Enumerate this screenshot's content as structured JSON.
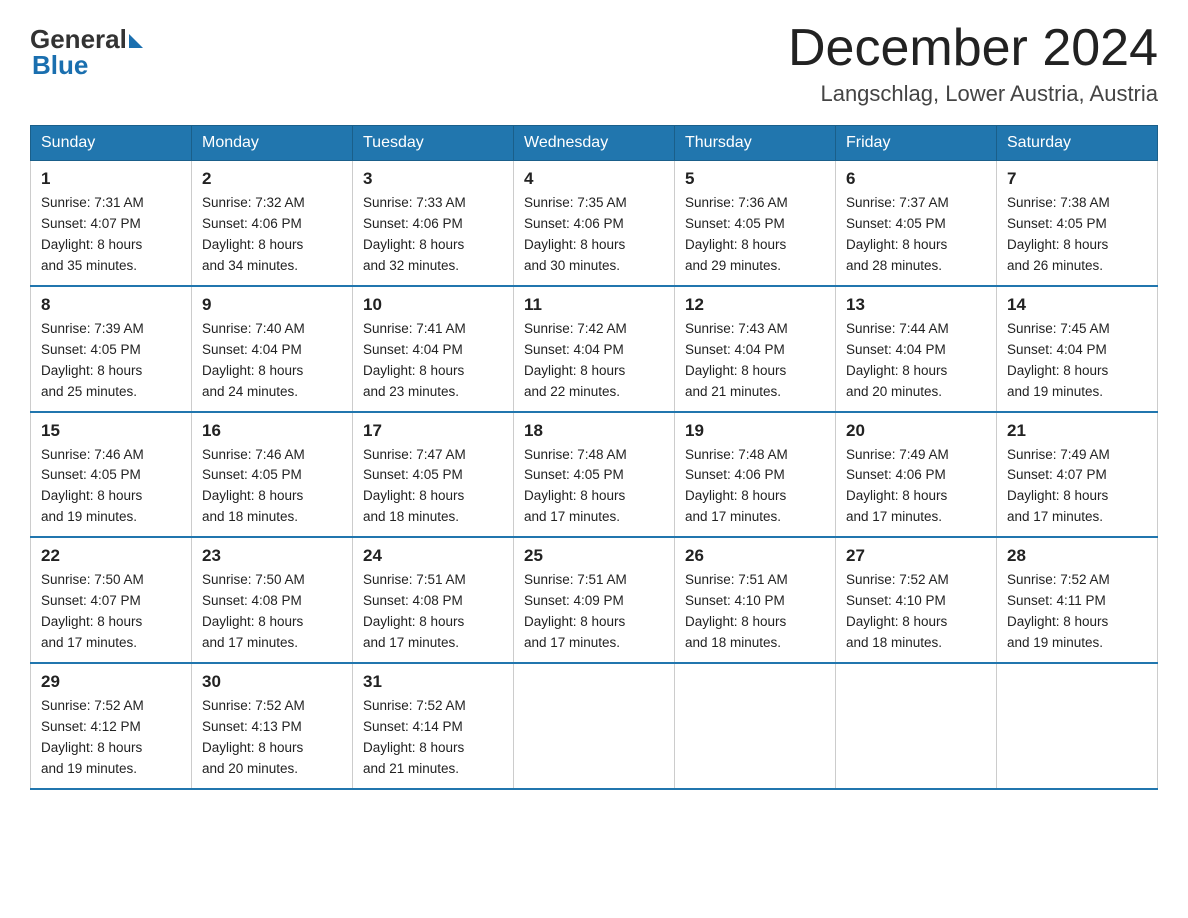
{
  "header": {
    "logo": {
      "general": "General",
      "blue": "Blue",
      "tagline": "GeneralBlue"
    },
    "title": "December 2024",
    "location": "Langschlag, Lower Austria, Austria"
  },
  "weekdays": [
    "Sunday",
    "Monday",
    "Tuesday",
    "Wednesday",
    "Thursday",
    "Friday",
    "Saturday"
  ],
  "weeks": [
    [
      {
        "day": "1",
        "sunrise": "7:31 AM",
        "sunset": "4:07 PM",
        "daylight": "8 hours and 35 minutes."
      },
      {
        "day": "2",
        "sunrise": "7:32 AM",
        "sunset": "4:06 PM",
        "daylight": "8 hours and 34 minutes."
      },
      {
        "day": "3",
        "sunrise": "7:33 AM",
        "sunset": "4:06 PM",
        "daylight": "8 hours and 32 minutes."
      },
      {
        "day": "4",
        "sunrise": "7:35 AM",
        "sunset": "4:06 PM",
        "daylight": "8 hours and 30 minutes."
      },
      {
        "day": "5",
        "sunrise": "7:36 AM",
        "sunset": "4:05 PM",
        "daylight": "8 hours and 29 minutes."
      },
      {
        "day": "6",
        "sunrise": "7:37 AM",
        "sunset": "4:05 PM",
        "daylight": "8 hours and 28 minutes."
      },
      {
        "day": "7",
        "sunrise": "7:38 AM",
        "sunset": "4:05 PM",
        "daylight": "8 hours and 26 minutes."
      }
    ],
    [
      {
        "day": "8",
        "sunrise": "7:39 AM",
        "sunset": "4:05 PM",
        "daylight": "8 hours and 25 minutes."
      },
      {
        "day": "9",
        "sunrise": "7:40 AM",
        "sunset": "4:04 PM",
        "daylight": "8 hours and 24 minutes."
      },
      {
        "day": "10",
        "sunrise": "7:41 AM",
        "sunset": "4:04 PM",
        "daylight": "8 hours and 23 minutes."
      },
      {
        "day": "11",
        "sunrise": "7:42 AM",
        "sunset": "4:04 PM",
        "daylight": "8 hours and 22 minutes."
      },
      {
        "day": "12",
        "sunrise": "7:43 AM",
        "sunset": "4:04 PM",
        "daylight": "8 hours and 21 minutes."
      },
      {
        "day": "13",
        "sunrise": "7:44 AM",
        "sunset": "4:04 PM",
        "daylight": "8 hours and 20 minutes."
      },
      {
        "day": "14",
        "sunrise": "7:45 AM",
        "sunset": "4:04 PM",
        "daylight": "8 hours and 19 minutes."
      }
    ],
    [
      {
        "day": "15",
        "sunrise": "7:46 AM",
        "sunset": "4:05 PM",
        "daylight": "8 hours and 19 minutes."
      },
      {
        "day": "16",
        "sunrise": "7:46 AM",
        "sunset": "4:05 PM",
        "daylight": "8 hours and 18 minutes."
      },
      {
        "day": "17",
        "sunrise": "7:47 AM",
        "sunset": "4:05 PM",
        "daylight": "8 hours and 18 minutes."
      },
      {
        "day": "18",
        "sunrise": "7:48 AM",
        "sunset": "4:05 PM",
        "daylight": "8 hours and 17 minutes."
      },
      {
        "day": "19",
        "sunrise": "7:48 AM",
        "sunset": "4:06 PM",
        "daylight": "8 hours and 17 minutes."
      },
      {
        "day": "20",
        "sunrise": "7:49 AM",
        "sunset": "4:06 PM",
        "daylight": "8 hours and 17 minutes."
      },
      {
        "day": "21",
        "sunrise": "7:49 AM",
        "sunset": "4:07 PM",
        "daylight": "8 hours and 17 minutes."
      }
    ],
    [
      {
        "day": "22",
        "sunrise": "7:50 AM",
        "sunset": "4:07 PM",
        "daylight": "8 hours and 17 minutes."
      },
      {
        "day": "23",
        "sunrise": "7:50 AM",
        "sunset": "4:08 PM",
        "daylight": "8 hours and 17 minutes."
      },
      {
        "day": "24",
        "sunrise": "7:51 AM",
        "sunset": "4:08 PM",
        "daylight": "8 hours and 17 minutes."
      },
      {
        "day": "25",
        "sunrise": "7:51 AM",
        "sunset": "4:09 PM",
        "daylight": "8 hours and 17 minutes."
      },
      {
        "day": "26",
        "sunrise": "7:51 AM",
        "sunset": "4:10 PM",
        "daylight": "8 hours and 18 minutes."
      },
      {
        "day": "27",
        "sunrise": "7:52 AM",
        "sunset": "4:10 PM",
        "daylight": "8 hours and 18 minutes."
      },
      {
        "day": "28",
        "sunrise": "7:52 AM",
        "sunset": "4:11 PM",
        "daylight": "8 hours and 19 minutes."
      }
    ],
    [
      {
        "day": "29",
        "sunrise": "7:52 AM",
        "sunset": "4:12 PM",
        "daylight": "8 hours and 19 minutes."
      },
      {
        "day": "30",
        "sunrise": "7:52 AM",
        "sunset": "4:13 PM",
        "daylight": "8 hours and 20 minutes."
      },
      {
        "day": "31",
        "sunrise": "7:52 AM",
        "sunset": "4:14 PM",
        "daylight": "8 hours and 21 minutes."
      },
      null,
      null,
      null,
      null
    ]
  ],
  "labels": {
    "sunrise": "Sunrise:",
    "sunset": "Sunset:",
    "daylight": "Daylight:"
  }
}
